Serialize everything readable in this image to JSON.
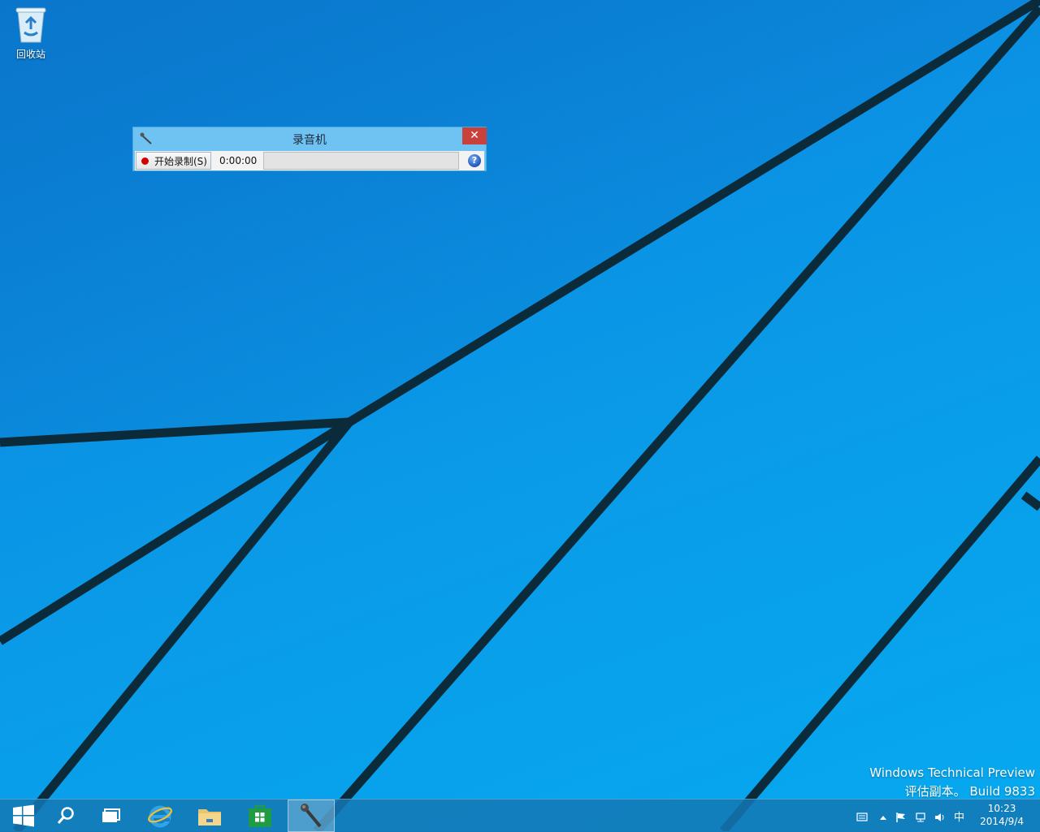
{
  "desktop": {
    "recycle_bin_label": "回收站"
  },
  "recorder": {
    "title": "录音机",
    "close_glyph": "✕",
    "record_button_label": "开始录制(S)",
    "elapsed_time": "0:00:00",
    "help_glyph": "?"
  },
  "watermark": {
    "line1": "Windows Technical Preview",
    "line2": "评估副本。 Build 9833"
  },
  "taskbar": {
    "items": [
      "start",
      "search",
      "task-view",
      "internet-explorer",
      "file-explorer",
      "store",
      "sound-recorder"
    ],
    "active_item": "sound-recorder",
    "tray": {
      "ime_indicator": "中",
      "time": "10:23",
      "date": "2014/9/4"
    }
  }
}
